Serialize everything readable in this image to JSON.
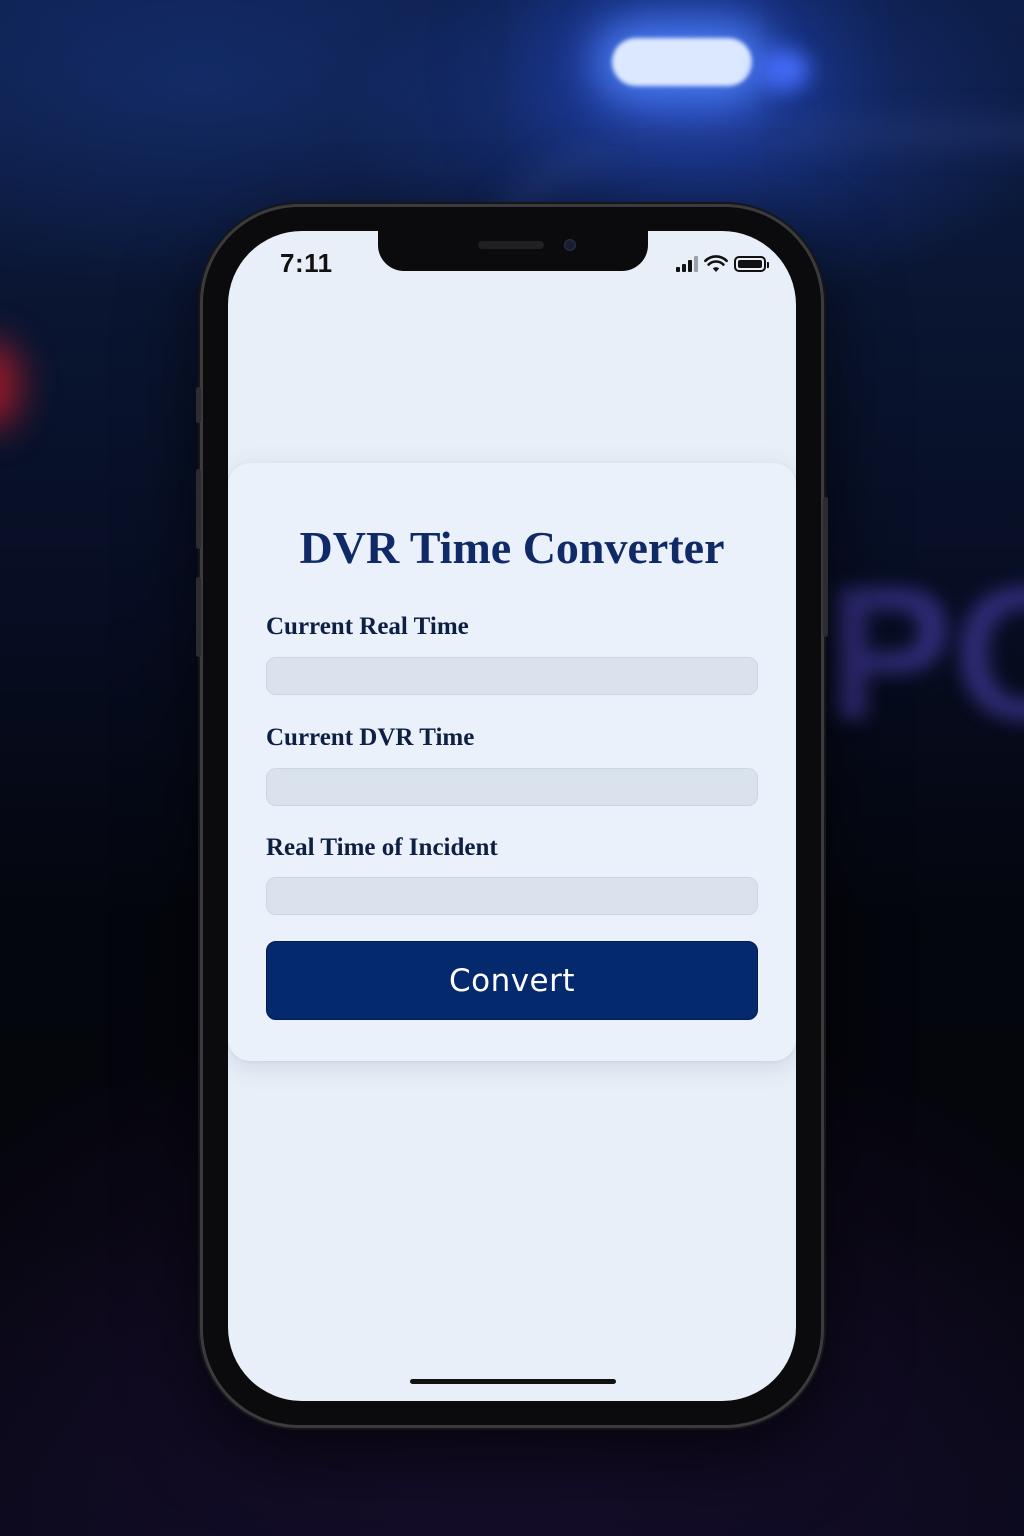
{
  "status_bar": {
    "time": "7:11",
    "icons": [
      "cellular-signal-icon",
      "wifi-icon",
      "battery-icon"
    ]
  },
  "app": {
    "title": "DVR Time Converter",
    "fields": [
      {
        "label": "Current Real Time",
        "value": "",
        "placeholder": ""
      },
      {
        "label": "Current DVR Time",
        "value": "",
        "placeholder": ""
      },
      {
        "label": "Real Time of Incident",
        "value": "",
        "placeholder": ""
      }
    ],
    "convert_label": "Convert"
  },
  "background": {
    "visible_text_left": "",
    "visible_text_right": "POLI"
  },
  "colors": {
    "title": "#0f2a66",
    "button": "#04296c",
    "screen_bg": "#e8eff8",
    "input_bg": "#dae3ed"
  }
}
